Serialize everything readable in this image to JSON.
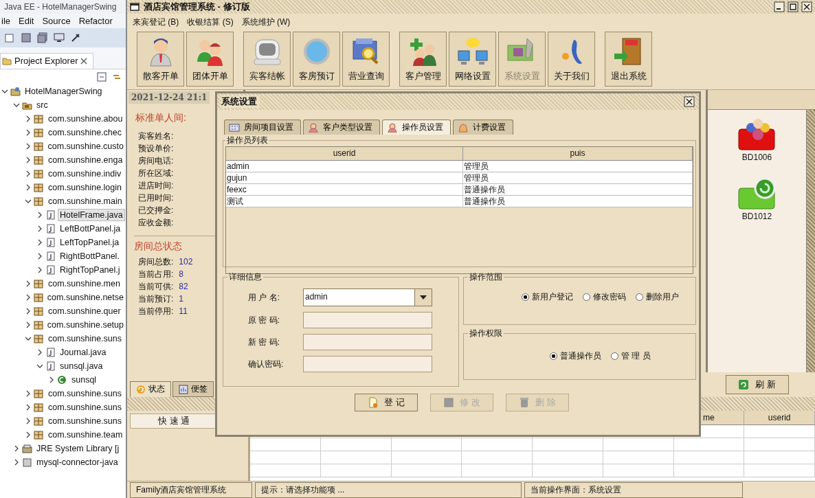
{
  "ide": {
    "title": "Java EE - HotelManagerSwing",
    "menu": [
      "ile",
      "Edit",
      "Source",
      "Refactor"
    ],
    "view_tab": "Project Explorer",
    "tree": [
      {
        "label": "HotelManagerSwing",
        "kind": "project",
        "expanded": true,
        "selected": false,
        "children": [
          {
            "label": "src",
            "kind": "folder",
            "expanded": true,
            "selected": false,
            "children": [
              {
                "label": "com.sunshine.abou",
                "kind": "package",
                "expanded": false,
                "selected": false
              },
              {
                "label": "com.sunshine.chec",
                "kind": "package",
                "expanded": false,
                "selected": false
              },
              {
                "label": "com.sunshine.custo",
                "kind": "package",
                "expanded": false,
                "selected": false
              },
              {
                "label": "com.sunshine.enga",
                "kind": "package",
                "expanded": false,
                "selected": false
              },
              {
                "label": "com.sunshine.indiv",
                "kind": "package",
                "expanded": false,
                "selected": false
              },
              {
                "label": "com.sunshine.login",
                "kind": "package",
                "expanded": false,
                "selected": false
              },
              {
                "label": "com.sunshine.main",
                "kind": "package",
                "expanded": true,
                "selected": false,
                "children": [
                  {
                    "label": "HotelFrame.java",
                    "kind": "file",
                    "expanded": false,
                    "selected": true
                  },
                  {
                    "label": "LeftBottPanel.ja",
                    "kind": "file",
                    "expanded": false,
                    "selected": false
                  },
                  {
                    "label": "LeftTopPanel.ja",
                    "kind": "file",
                    "expanded": false,
                    "selected": false
                  },
                  {
                    "label": "RightBottPanel.",
                    "kind": "file",
                    "expanded": false,
                    "selected": false
                  },
                  {
                    "label": "RightTopPanel.j",
                    "kind": "file",
                    "expanded": false,
                    "selected": false
                  }
                ]
              },
              {
                "label": "com.sunshine.men",
                "kind": "package",
                "expanded": false,
                "selected": false
              },
              {
                "label": "com.sunshine.netse",
                "kind": "package",
                "expanded": false,
                "selected": false
              },
              {
                "label": "com.sunshine.quer",
                "kind": "package",
                "expanded": false,
                "selected": false
              },
              {
                "label": "com.sunshine.setup",
                "kind": "package",
                "expanded": false,
                "selected": false
              },
              {
                "label": "com.sunshine.suns",
                "kind": "package",
                "expanded": true,
                "selected": false,
                "children": [
                  {
                    "label": "Journal.java",
                    "kind": "file",
                    "expanded": false,
                    "selected": false
                  },
                  {
                    "label": "sunsql.java",
                    "kind": "file",
                    "expanded": true,
                    "selected": false,
                    "children": [
                      {
                        "label": "sunsql",
                        "kind": "class",
                        "expanded": false,
                        "selected": false
                      }
                    ]
                  }
                ]
              },
              {
                "label": "com.sunshine.suns",
                "kind": "package",
                "expanded": false,
                "selected": false
              },
              {
                "label": "com.sunshine.suns",
                "kind": "package",
                "expanded": false,
                "selected": false
              },
              {
                "label": "com.sunshine.suns",
                "kind": "package",
                "expanded": false,
                "selected": false
              },
              {
                "label": "com.sunshine.team",
                "kind": "package",
                "expanded": false,
                "selected": false
              }
            ]
          },
          {
            "label": "JRE System Library [j",
            "kind": "library",
            "expanded": false,
            "selected": false
          },
          {
            "label": "mysql-connector-java",
            "kind": "jar",
            "expanded": false,
            "selected": false
          }
        ]
      }
    ]
  },
  "app": {
    "title": "酒店宾馆管理系统 - 修订版",
    "menu": [
      "来宾登记 (B)",
      "收银结算 (S)",
      "系统维护 (W)"
    ],
    "toolbar": [
      {
        "items": [
          {
            "label": "散客开单",
            "kind": "guest",
            "disabled": false
          },
          {
            "label": "团体开单",
            "kind": "group",
            "disabled": false
          }
        ]
      },
      {
        "items": [
          {
            "label": "宾客结帐",
            "kind": "checkout",
            "disabled": false
          },
          {
            "label": "客房预订",
            "kind": "booking",
            "disabled": false
          },
          {
            "label": "营业查询",
            "kind": "query",
            "disabled": false
          }
        ]
      },
      {
        "items": [
          {
            "label": "客户管理",
            "kind": "customer",
            "disabled": false
          },
          {
            "label": "网络设置",
            "kind": "network",
            "disabled": false
          },
          {
            "label": "系统设置",
            "kind": "settings",
            "disabled": true
          },
          {
            "label": "关于我们",
            "kind": "about",
            "disabled": false
          }
        ]
      },
      {
        "items": [
          {
            "label": "退出系统",
            "kind": "exit",
            "disabled": false
          }
        ]
      }
    ],
    "left_panel": {
      "datetime": "2021-12-24  21:1",
      "room_title": "标准单人间:",
      "room_fields": [
        "宾客姓名:",
        "预设单价:",
        "房间电话:",
        "所在区域:",
        "进店时间:",
        "已用时间:",
        "已交押金:",
        "应收金额:"
      ],
      "status_title": "房间总状态",
      "stats": [
        {
          "label": "房间总数:",
          "value": "102"
        },
        {
          "label": "当前占用:",
          "value": "8"
        },
        {
          "label": "当前可供:",
          "value": "82"
        },
        {
          "label": "当前预订:",
          "value": "1"
        },
        {
          "label": "当前停用:",
          "value": "11"
        }
      ]
    },
    "bottom_tabs": [
      {
        "label": "状态",
        "kind": "status",
        "selected": true
      },
      {
        "label": "便签",
        "kind": "note",
        "selected": false
      }
    ],
    "quick_channel": "快 速 通",
    "rooms": [
      {
        "name": "BD1006",
        "kind": "occupied"
      },
      {
        "name": "BD1012",
        "kind": "available"
      }
    ],
    "refresh_button": "刷 新",
    "table_columns": [
      "me",
      "userid"
    ],
    "status_bar": [
      "Family酒店宾馆管理系统",
      "提示：请选择功能项 ...",
      "当前操作界面：系统设置"
    ]
  },
  "dialog": {
    "title": "系统设置",
    "tabs": [
      {
        "label": "房间项目设置",
        "kind": "rooms",
        "selected": false
      },
      {
        "label": "客户类型设置",
        "kind": "customer",
        "selected": false
      },
      {
        "label": "操作员设置",
        "kind": "operator",
        "selected": true
      },
      {
        "label": "计费设置",
        "kind": "billing",
        "selected": false
      }
    ],
    "list_title": "操作员列表",
    "columns": [
      "userid",
      "puis"
    ],
    "rows": [
      [
        "admin",
        "管理员"
      ],
      [
        "gujun",
        "管理员"
      ],
      [
        "feexc",
        "普通操作员"
      ],
      [
        "测试",
        "普通操作员"
      ]
    ],
    "details_title": "详细信息",
    "username": {
      "label": "用 户 名:",
      "value": "admin"
    },
    "password_fields": [
      "原 密 码:",
      "新 密 码:",
      "确认密码:"
    ],
    "scope_title": "操作范围",
    "scope_options": [
      {
        "label": "新用户登记",
        "selected": true
      },
      {
        "label": "修改密码",
        "selected": false
      },
      {
        "label": "删除用户",
        "selected": false
      }
    ],
    "rights_title": "操作权限",
    "rights_options": [
      {
        "label": "普通操作员",
        "selected": true
      },
      {
        "label": "管 理 员",
        "selected": false
      }
    ],
    "buttons": [
      {
        "label": "登 记",
        "kind": "register",
        "disabled": false
      },
      {
        "label": "修 改",
        "kind": "edit",
        "disabled": true
      },
      {
        "label": "删 除",
        "kind": "delete",
        "disabled": true
      }
    ]
  }
}
